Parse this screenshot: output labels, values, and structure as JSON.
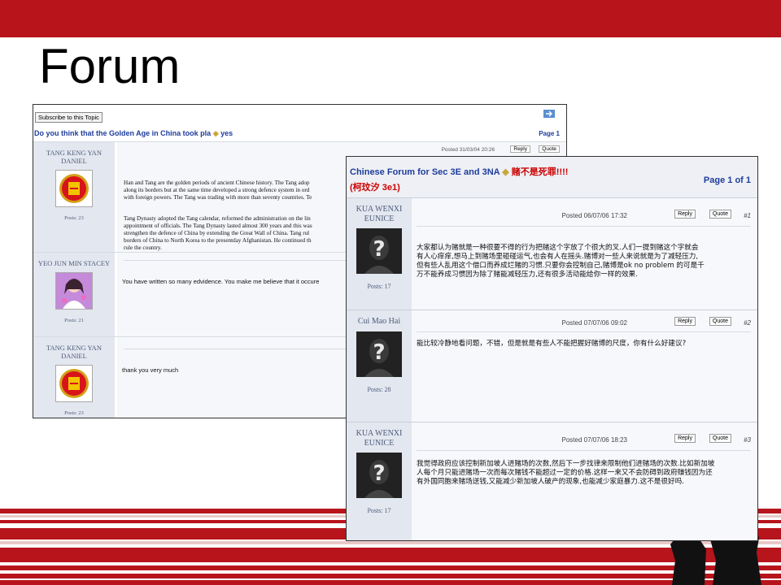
{
  "slide": {
    "title": "Forum",
    "accent": "#b7141b"
  },
  "shot1": {
    "subscribe_label": "Subscribe to this Topic",
    "topic_title": "Do you think that the Golden Age in China took pla",
    "topic_suffix": "yes",
    "page_label": "Page 1",
    "quote_label": "Quote",
    "reply_label": "Reply",
    "posts": [
      {
        "user": "TANG KENG YAN DANIEL",
        "posts": "Posts: 23",
        "avatar_icon": "manchester-united-crest-icon",
        "posted": "Posted 31/03/04 20:26",
        "paragraphs": [
          "Han and Tang are the golden periods of ancient Chinese history. The Tang adop",
          "along its borders but at the same time developed a strong defence system in ord",
          "with foreign powers. The Tang was trading with more than seventy countries. Te",
          "Tang Dynasty adopted the Tang calendar, reformed  the administration on the lin",
          "appointment of officials. The Tang Dynasty lasted almost 300 years and this was",
          "strengthen the defence of China by extending the Great Wall of China. Tang rul",
          "borders of China to North Korea to the presentday Afghanistan. He continued th",
          "rule the country."
        ]
      },
      {
        "user": "YEO JUN MIN STACEY",
        "posts": "Posts: 21",
        "avatar_icon": "anime-girl-avatar-icon",
        "message": "You have written so many edvidence. You make me believe that it occure"
      },
      {
        "user": "TANG KENG YAN DANIEL",
        "posts": "Posts: 23",
        "avatar_icon": "manchester-united-crest-icon",
        "message": "thank you very much"
      }
    ]
  },
  "shot2": {
    "title": "Chinese Forum for Sec 3E and 3NA",
    "title_chinese": "赌不是死罪!!!!",
    "subtitle": "(柯玟汐  3e1)",
    "page_label": "Page 1 of 1",
    "reply_label": "Reply",
    "quote_label": "Quote",
    "posts": [
      {
        "user": "KUA WENXI EUNICE",
        "posts": "Posts: 17",
        "posted": "Posted 06/07/06 17:32",
        "num": "#1",
        "text": "大家都认为赌就是一种很要不得的行为把赌这个字放了个很大的叉.人们一提到赌这个字就会\n有人心痒痒,想马上到赌场里碰碰运气,也会有人在摇头.赌博对一些人来说就是为了减轻压力,\n但有些人乱用这个借口而养成烂赌的习惯.只要你会控制自己,赌博是ok no problem 的可是千\n万不能养成习惯因为除了赌能减轻压力,还有很多活动能给你一样的效果."
      },
      {
        "user": "Cui Mao Hai",
        "posts": "Posts: 28",
        "posted": "Posted 07/07/06 09:02",
        "num": "#2",
        "text": "能比较冷静地看问题，不错，但是就是有些人不能把握好赌博的尺度，你有什么好建议?"
      },
      {
        "user": "KUA WENXI EUNICE",
        "posts": "Posts: 17",
        "posted": "Posted 07/07/06 18:23",
        "num": "#3",
        "text": "我觉得政府应该控制新加坡人进赌场的次数,然后下一步找律来限制他们进赌场的次数.比如新加坡\n人每个月只能进赌场一次而每次赌钱不能超过一定的价格.这样一来又不会防碍到政府赚钱因为还\n有外国同胞来赌场送钱,又能减少新加坡人破产的现象,也能减少家庭暴力.这不是很好吗."
      }
    ]
  }
}
